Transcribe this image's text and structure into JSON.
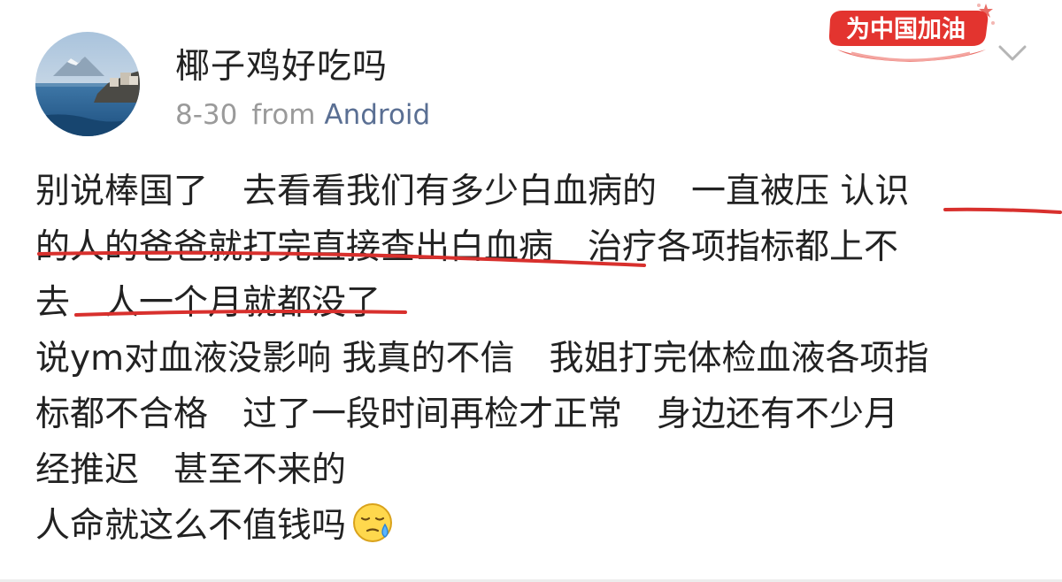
{
  "post": {
    "author": {
      "name": "椰子鸡好吃吗",
      "avatar": "avatar-seaside-photo"
    },
    "meta": {
      "date": "8-30",
      "from_label": "from",
      "source": "Android"
    },
    "badge": {
      "text": "为中国加油",
      "icon": "cheer-china-badge"
    },
    "menu_icon": "chevron-down-icon",
    "content_lines": [
      "别说棒国了　去看看我们有多少白血病的　一直被压 认识",
      "的人的爸爸就打完直接查出白血病　治疗各项指标都上不",
      "去　人一个月就都没了",
      "说ym对血液没影响 我真的不信　我姐打完体检血液各项指",
      "标都不合格　过了一段时间再检才正常　身边还有不少月",
      "经推迟　甚至不来的",
      "人命就这么不值钱吗"
    ],
    "emoji": "sweat-emoji",
    "colors": {
      "text": "#222222",
      "meta": "#9a9a9a",
      "source": "#5a6f93",
      "highlight": "#d8302d",
      "badge": "#e3342f"
    }
  }
}
